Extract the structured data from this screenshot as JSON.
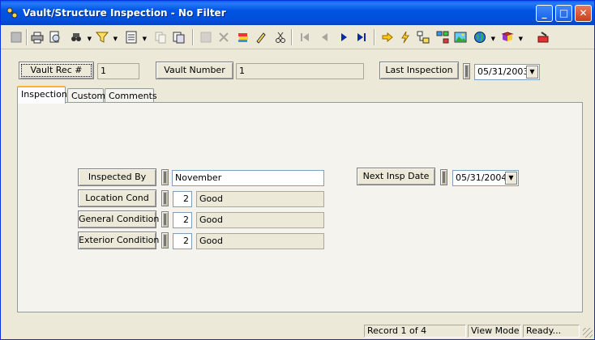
{
  "window": {
    "title": "Vault/Structure Inspection - No Filter"
  },
  "caption_buttons": {
    "minimize": "_",
    "maximize": "□",
    "close": "✕"
  },
  "toolbar": {
    "icons": [
      "save-icon",
      "print-icon",
      "print-preview-icon",
      "find-icon",
      "filter-icon",
      "view-icon",
      "copy-icon",
      "paste-icon",
      "record-icon",
      "delete-icon",
      "layers-icon",
      "edit-pencil-icon",
      "cut-icon",
      "first-record-icon",
      "prev-record-icon",
      "next-record-icon",
      "last-record-icon",
      "go-to-icon",
      "lightning-icon",
      "tree-icon",
      "network-icon",
      "picture-icon",
      "globe-icon",
      "book-icon",
      "mail-icon"
    ]
  },
  "header": {
    "vault_rec_label": "Vault Rec #",
    "vault_rec_value": "1",
    "vault_number_label": "Vault Number",
    "vault_number_value": "1",
    "last_inspection_label": "Last Inspection",
    "last_inspection_value": "05/31/2003"
  },
  "tabs": [
    {
      "label": "Inspection",
      "active": true
    },
    {
      "label": "Custom",
      "active": false
    },
    {
      "label": "Comments",
      "active": false
    }
  ],
  "inspection": {
    "inspected_by_label": "Inspected By",
    "inspected_by_value": "November",
    "location_cond_label": "Location Cond",
    "location_cond_code": "2",
    "location_cond_text": "Good",
    "general_condition_label": "General Condition",
    "general_condition_code": "2",
    "general_condition_text": "Good",
    "exterior_condition_label": "Exterior Condition",
    "exterior_condition_code": "2",
    "exterior_condition_text": "Good",
    "next_insp_date_label": "Next Insp Date",
    "next_insp_date_value": "05/31/2004"
  },
  "status": {
    "record": "Record 1 of 4",
    "mode": "View Mode",
    "state": "Ready..."
  },
  "colors": {
    "titlebar": "#0054e3",
    "face": "#ece9d8",
    "tab_highlight": "#f8b332"
  }
}
